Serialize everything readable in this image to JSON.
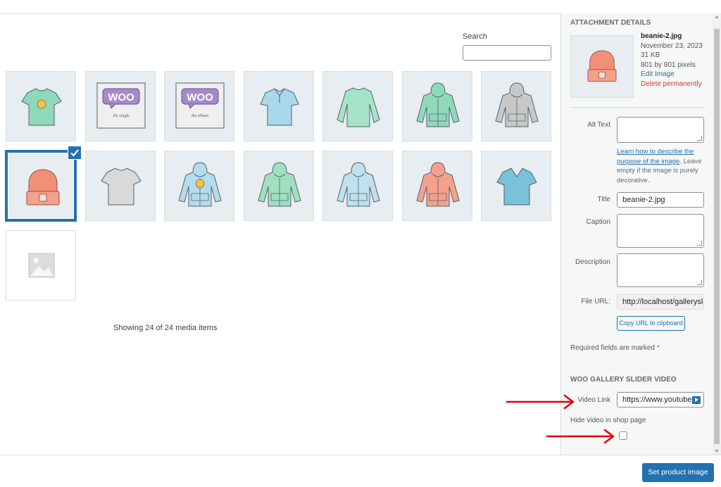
{
  "search": {
    "label": "Search",
    "placeholder": "",
    "value": ""
  },
  "grid": {
    "items": [
      {
        "kind": "tshirt",
        "color": "#8fd9bb",
        "extra": "badge"
      },
      {
        "kind": "woo-poster",
        "subtitle": "the single"
      },
      {
        "kind": "woo-poster",
        "subtitle": "the album"
      },
      {
        "kind": "polo",
        "color": "#a9d8ea"
      },
      {
        "kind": "longsleeve",
        "color": "#a6e3c8"
      },
      {
        "kind": "hoodie",
        "color": "#8fd9bb"
      },
      {
        "kind": "hoodie",
        "color": "#c8c8c8"
      },
      {
        "kind": "beanie",
        "color": "#f28f79",
        "selected": true
      },
      {
        "kind": "tshirt",
        "color": "#d9d9d9"
      },
      {
        "kind": "hoodie",
        "color": "#b5dced",
        "extra": "badge"
      },
      {
        "kind": "hoodie",
        "color": "#9fe0bf"
      },
      {
        "kind": "hoodie",
        "color": "#bfe0ee"
      },
      {
        "kind": "hoodie",
        "color": "#f5a08c"
      },
      {
        "kind": "vneck",
        "color": "#79c2d8"
      },
      {
        "kind": "placeholder"
      }
    ],
    "count_text": "Showing 24 of 24 media items"
  },
  "sidebar": {
    "header": "ATTACHMENT DETAILS",
    "file_name": "beanie-2.jpg",
    "date": "November 23, 2023",
    "size": "31 KB",
    "dimensions": "801 by 801 pixels",
    "edit_link": "Edit Image",
    "delete_link": "Delete permanently",
    "alt_text_label": "Alt Text",
    "alt_text_value": "",
    "alt_help_link": "Learn how to describe the purpose of the image",
    "alt_help_rest": ". Leave empty if the image is purely decorative.",
    "title_label": "Title",
    "title_value": "beanie-2.jpg",
    "caption_label": "Caption",
    "description_label": "Description",
    "file_url_label": "File URL:",
    "file_url_value": "http://localhost/gallerysli",
    "copy_button": "Copy URL to clipboard",
    "required_text": "Required fields are marked",
    "required_mark": "*",
    "section2_header": "WOO GALLERY SLIDER VIDEO",
    "video_link_label": "Video Link",
    "video_link_value": "https://www.youtube.c",
    "hide_video_label": "Hide video in shop page",
    "hide_video_checked": false
  },
  "footer": {
    "set_button": "Set product image"
  },
  "colors": {
    "accent": "#2271b1",
    "danger": "#d63638",
    "annotation_arrow": "#e3000b"
  }
}
